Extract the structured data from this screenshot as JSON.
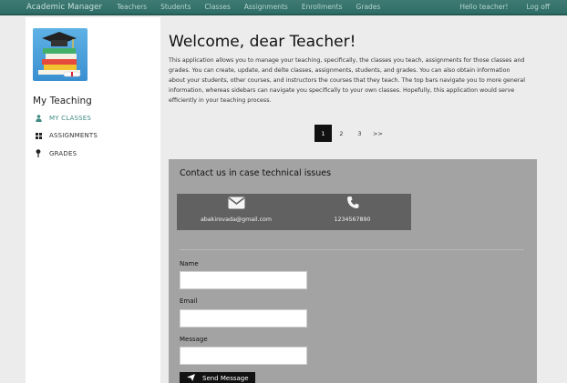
{
  "navbar": {
    "brand": "Academic Manager",
    "links": [
      "Teachers",
      "Students",
      "Classes",
      "Assignments",
      "Enrollments",
      "Grades"
    ],
    "greeting": "Hello teacher!",
    "logout": "Log off"
  },
  "sidebar": {
    "title": "My Teaching",
    "items": [
      {
        "label": "MY CLASSES",
        "icon": "user-icon"
      },
      {
        "label": "ASSIGNMENTS",
        "icon": "grid-icon"
      },
      {
        "label": "GRADES",
        "icon": "pin-icon"
      }
    ]
  },
  "main": {
    "heading": "Welcome, dear Teacher!",
    "intro": "This application allows you to manage your teaching, specifically, the classes you teach, assignments for those classes and grades. You can create, update, and delte classes, assignments, students, and grades. You can also obtain information about your students, other courses, and instructors the courses that they teach. The top bars navigate you to more general information, whereas sidebars can navigate you specifically to your own classes. Hopefully, this application would serve efficiently in your teaching process.",
    "pagination": [
      "1",
      "2",
      "3",
      ">>"
    ],
    "current_page": "1"
  },
  "contact": {
    "title": "Contact us in case technical issues",
    "email": "abakirovada@gmail.com",
    "phone": "1234567890",
    "labels": {
      "name": "Name",
      "email": "Email",
      "message": "Message"
    },
    "values": {
      "name": "",
      "email": "",
      "message": ""
    },
    "send_label": "Send Message"
  },
  "colors": {
    "navbar": "#2e6e66",
    "accent": "#3f8b83",
    "panel": "#a3a3a3",
    "contact_box": "#616161"
  }
}
